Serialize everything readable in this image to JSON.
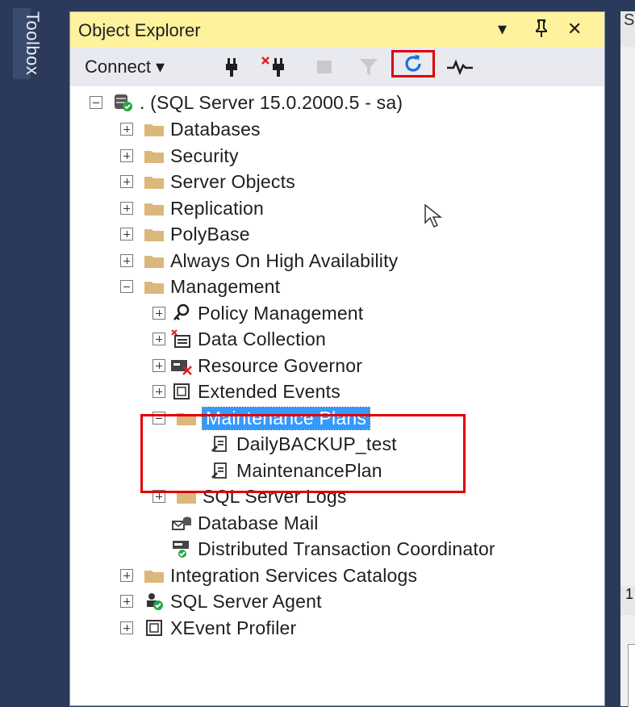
{
  "toolbox": {
    "label": "Toolbox"
  },
  "right_pane": {
    "tab_top": "S",
    "tab_mid": "1"
  },
  "object_explorer": {
    "title": "Object Explorer",
    "title_buttons": {
      "dropdown": "▾",
      "pin": "⊥",
      "close": "✕"
    },
    "toolbar": {
      "connect_label": "Connect ▾",
      "icons": [
        "connect-icon",
        "disconnect-icon",
        "stop-icon",
        "filter-icon",
        "refresh-icon",
        "activity-monitor-icon"
      ]
    },
    "tree": {
      "server": ". (SQL Server 15.0.2000.5 - sa)",
      "nodes": [
        {
          "label": "Databases"
        },
        {
          "label": "Security"
        },
        {
          "label": "Server Objects"
        },
        {
          "label": "Replication"
        },
        {
          "label": "PolyBase"
        },
        {
          "label": "Always On High Availability"
        },
        {
          "label": "Management"
        },
        {
          "label": "Policy Management"
        },
        {
          "label": "Data Collection"
        },
        {
          "label": "Resource Governor"
        },
        {
          "label": "Extended Events"
        },
        {
          "label": "Maintenance Plans"
        },
        {
          "label": "DailyBACKUP_test"
        },
        {
          "label": "MaintenancePlan"
        },
        {
          "label": "SQL Server Logs"
        },
        {
          "label": "Database Mail"
        },
        {
          "label": "Distributed Transaction Coordinator"
        },
        {
          "label": "Integration Services Catalogs"
        },
        {
          "label": "SQL Server Agent"
        },
        {
          "label": "XEvent Profiler"
        }
      ]
    }
  },
  "colors": {
    "title_bar": "#fff29d",
    "selection": "#3399ff",
    "highlight": "#e00000",
    "folder": "#dcb67a"
  }
}
